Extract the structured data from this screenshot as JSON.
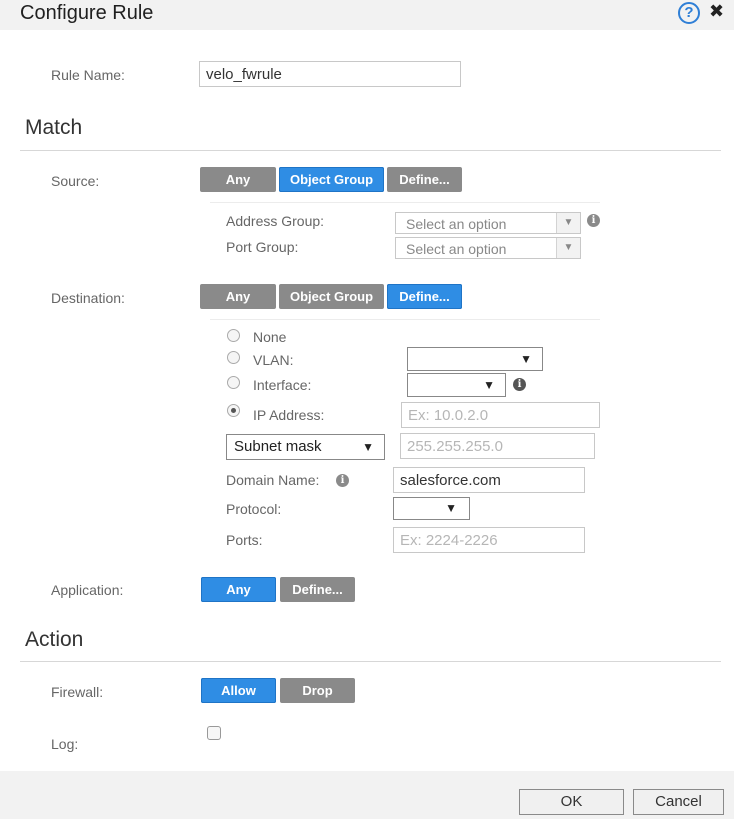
{
  "dialog": {
    "title": "Configure Rule",
    "help_icon": "?",
    "close_icon": "✖"
  },
  "rule_name": {
    "label": "Rule Name:",
    "value": "velo_fwrule"
  },
  "match": {
    "heading": "Match",
    "source": {
      "label": "Source:",
      "buttons": [
        "Any",
        "Object Group",
        "Define..."
      ],
      "selected": "Object Group",
      "address_group": {
        "label": "Address Group:",
        "placeholder": "Select an option"
      },
      "port_group": {
        "label": "Port Group:",
        "placeholder": "Select an option"
      }
    },
    "destination": {
      "label": "Destination:",
      "buttons": [
        "Any",
        "Object Group",
        "Define..."
      ],
      "selected": "Define...",
      "radios": [
        {
          "label": "None",
          "checked": false
        },
        {
          "label": "VLAN:",
          "checked": false
        },
        {
          "label": "Interface:",
          "checked": false
        },
        {
          "label": "IP Address:",
          "checked": true
        }
      ],
      "ip_placeholder": "Ex: 10.0.2.0",
      "mask_type": "Subnet mask",
      "mask_placeholder": "255.255.255.0",
      "domain_label": "Domain Name:",
      "domain_value": "salesforce.com",
      "protocol_label": "Protocol:",
      "ports_label": "Ports:",
      "ports_placeholder": "Ex: 2224-2226",
      "caret": "▼"
    },
    "application": {
      "label": "Application:",
      "buttons": [
        "Any",
        "Define..."
      ],
      "selected": "Any"
    }
  },
  "action": {
    "heading": "Action",
    "firewall": {
      "label": "Firewall:",
      "buttons": [
        "Allow",
        "Drop"
      ],
      "selected": "Allow"
    },
    "log": {
      "label": "Log:",
      "checked": false
    }
  },
  "footer": {
    "ok": "OK",
    "cancel": "Cancel"
  },
  "colors": {
    "accent": "#2f8de4",
    "button_grey": "#8a8a8a"
  }
}
